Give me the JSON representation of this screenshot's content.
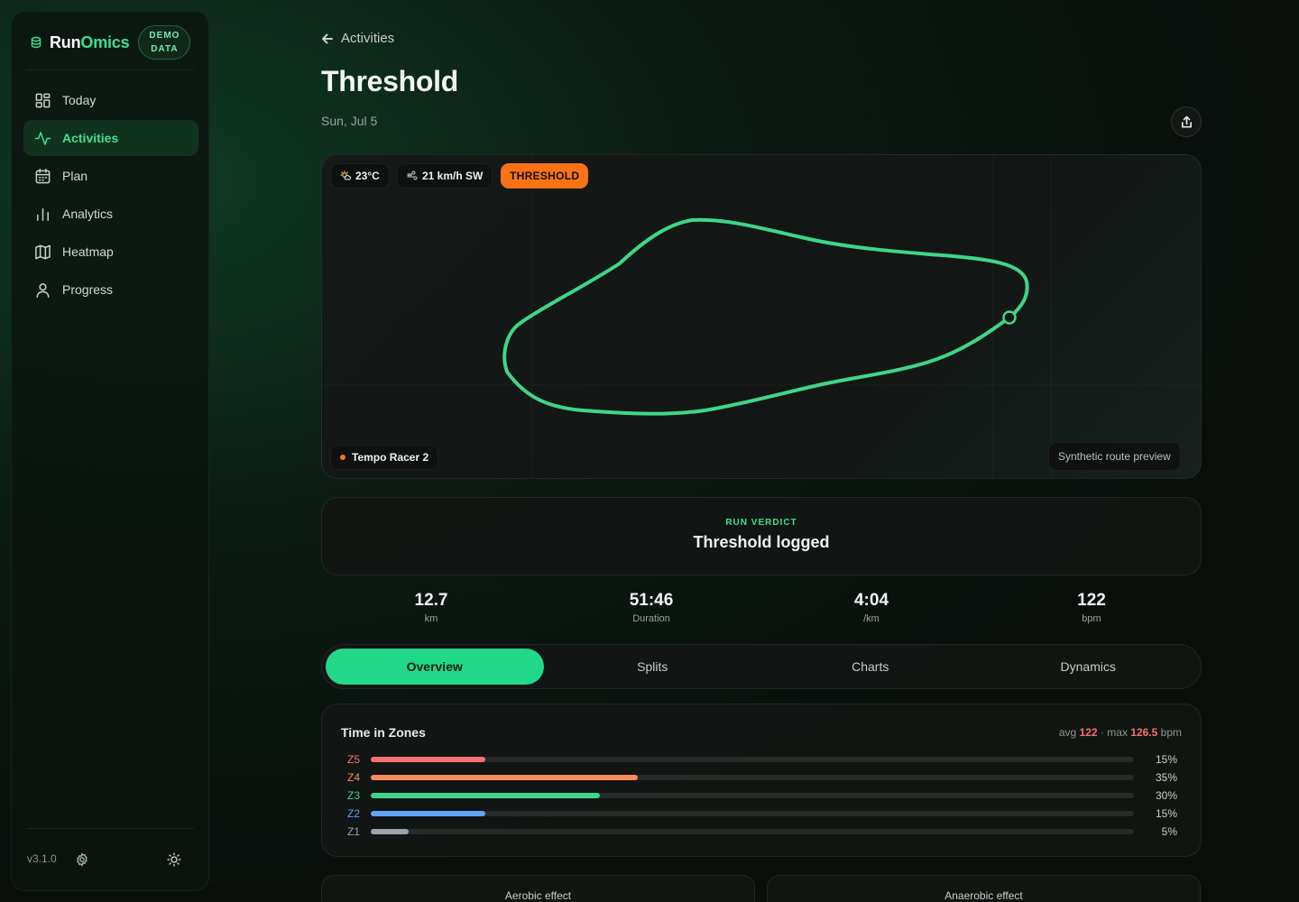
{
  "brand": {
    "name_part1": "Run",
    "name_part2": "Omics",
    "badge_line1": "DEMO",
    "badge_line2": "DATA"
  },
  "sidebar": {
    "items": [
      {
        "label": "Today",
        "icon": "grid-icon"
      },
      {
        "label": "Activities",
        "icon": "activity-icon",
        "active": true
      },
      {
        "label": "Plan",
        "icon": "calendar-icon"
      },
      {
        "label": "Analytics",
        "icon": "bar-chart-icon"
      },
      {
        "label": "Heatmap",
        "icon": "map-icon"
      },
      {
        "label": "Progress",
        "icon": "user-icon"
      }
    ],
    "version": "v3.1.0"
  },
  "header": {
    "back_label": "Activities",
    "title": "Threshold",
    "date": "Sun, Jul 5"
  },
  "map": {
    "temperature": "23°C",
    "wind": "21 km/h SW",
    "workout_type": "THRESHOLD",
    "shoe": "Tempo Racer 2",
    "preview_label": "Synthetic route preview",
    "route_color": "#3ed68a"
  },
  "verdict": {
    "label": "RUN VERDICT",
    "text": "Threshold logged"
  },
  "stats": [
    {
      "value": "12.7",
      "unit": "km"
    },
    {
      "value": "51:46",
      "unit": "Duration"
    },
    {
      "value": "4:04",
      "unit": "/km"
    },
    {
      "value": "122",
      "unit": "bpm"
    }
  ],
  "tabs": [
    {
      "label": "Overview",
      "active": true
    },
    {
      "label": "Splits"
    },
    {
      "label": "Charts"
    },
    {
      "label": "Dynamics"
    }
  ],
  "zones": {
    "title": "Time in Zones",
    "avg_label": "avg",
    "avg_value": "122",
    "max_label": "· max",
    "max_value": "126.5",
    "unit": "bpm",
    "rows": [
      {
        "label": "Z5",
        "pct_text": "15%",
        "fraction": 0.15,
        "color": "#f87171"
      },
      {
        "label": "Z4",
        "pct_text": "35%",
        "fraction": 0.35,
        "color": "#fb8c5a"
      },
      {
        "label": "Z3",
        "pct_text": "30%",
        "fraction": 0.3,
        "color": "#3ed68a"
      },
      {
        "label": "Z2",
        "pct_text": "15%",
        "fraction": 0.15,
        "color": "#60a5fa"
      },
      {
        "label": "Z1",
        "pct_text": "5%",
        "fraction": 0.05,
        "color": "#9ca3af"
      }
    ]
  },
  "effects": {
    "aerobic_label": "Aerobic effect",
    "anaerobic_label": "Anaerobic effect"
  }
}
